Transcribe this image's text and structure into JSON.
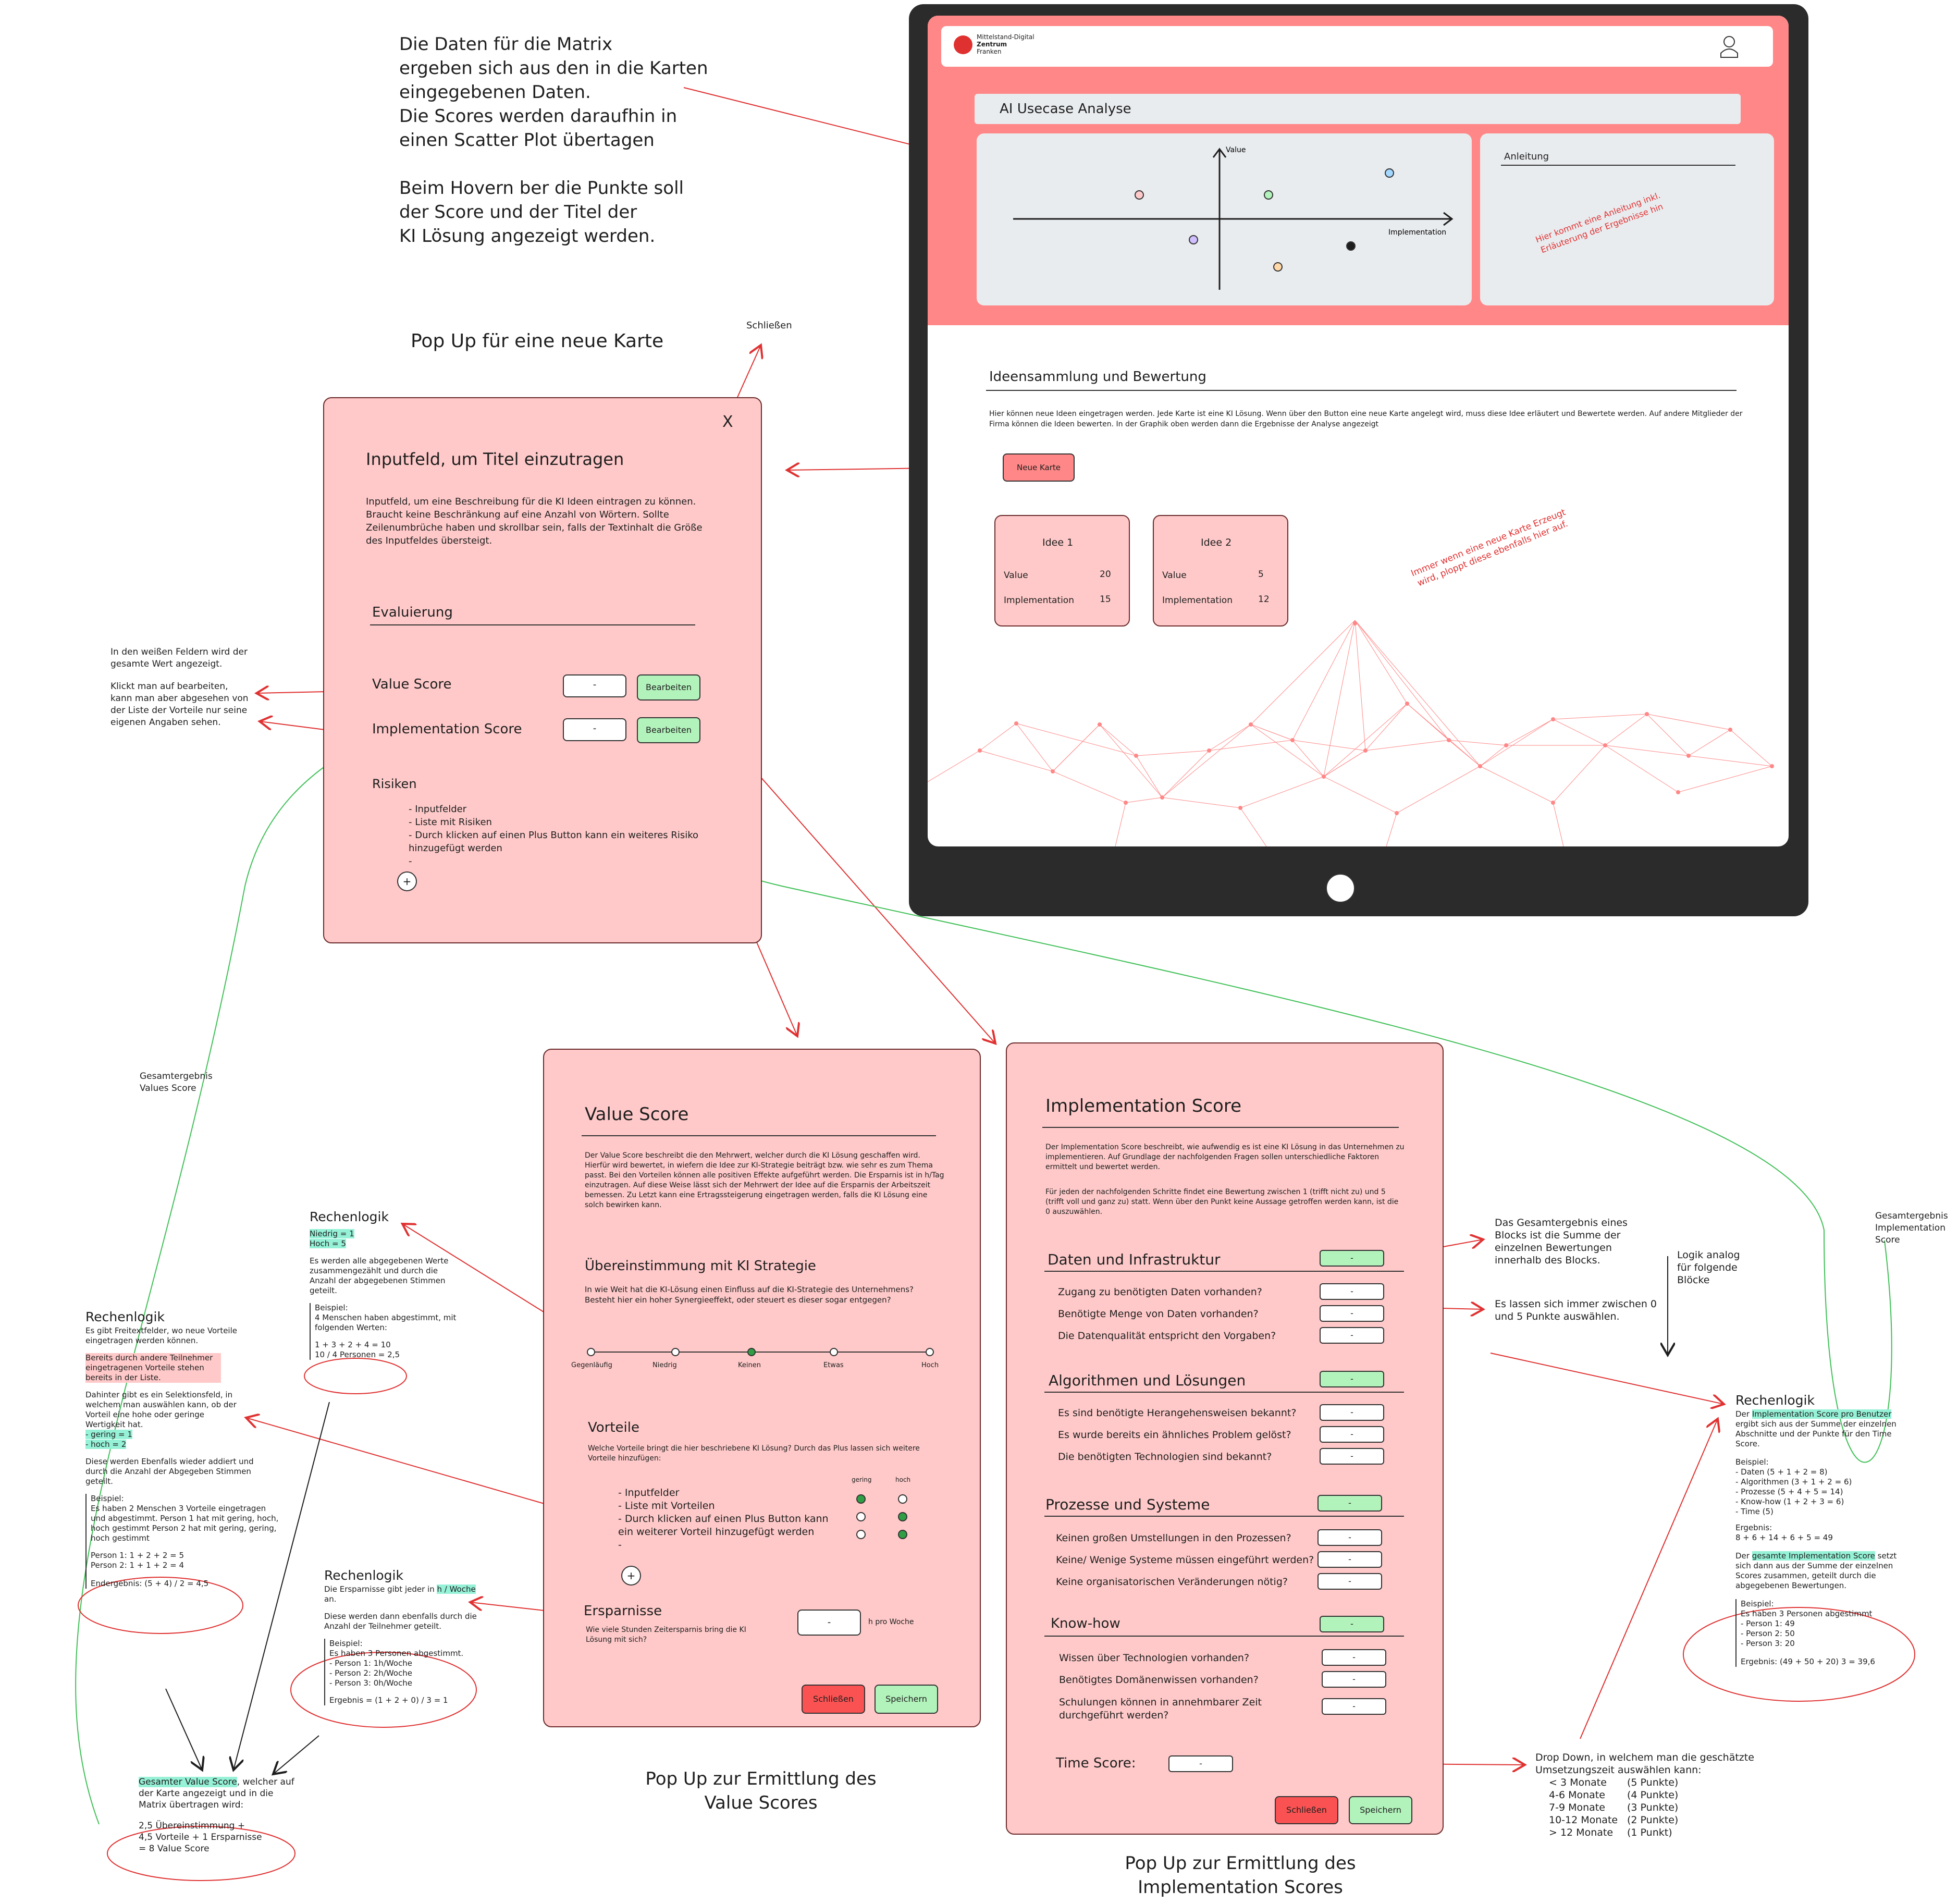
{
  "top_note": {
    "lines": [
      "Die Daten für die Matrix",
      "ergeben sich aus den in die Karten",
      "eingegebenen Daten.",
      "Die Scores werden daraufhin in",
      "einen Scatter Plot übertagen",
      "",
      "Beim Hovern ber die Punkte soll",
      "der Score und der Titel der",
      "KI Lösung angezeigt werden."
    ]
  },
  "popup_new_card_title": "Pop Up für eine neue Karte",
  "close_label": "Schließen",
  "tablet": {
    "logo_line1": "Mittelstand-Digital",
    "logo_line2": "Zentrum",
    "logo_line3": "Franken",
    "analysis_title": "AI Usecase Analyse",
    "axis_value": "Value",
    "axis_impl": "Implementation",
    "instructions_title": "Anleitung",
    "instructions_note": "Hier kommt eine Anleitung inkl. Erläuterung der Ergebnisse hin",
    "ideas_title": "Ideensammlung und Bewertung",
    "ideas_text": "Hier können neue Ideen eingetragen werden. Jede Karte ist eine KI Lösung. Wenn über den Button eine neue Karte angelegt wird, muss diese Idee erläutert und Bewertete werden. Auf andere Mitglieder der Firma können die Ideen bewerten. In der Graphik oben werden dann die Ergebnisse der Analyse angezeigt",
    "new_card_button": "Neue Karte",
    "cards": [
      {
        "title": "Idee 1",
        "value_label": "Value",
        "value": "20",
        "impl_label": "Implementation",
        "impl": "15"
      },
      {
        "title": "Idee 2",
        "value_label": "Value",
        "value": "5",
        "impl_label": "Implementation",
        "impl": "12"
      }
    ],
    "new_card_note": "Immer wenn eine neue Karte Erzeugt wird, ploppt diese ebenfalls hier auf."
  },
  "new_card_popup": {
    "close_x": "X",
    "title_field": "Inputfeld, um Titel einzutragen",
    "desc_field": "Inputfeld, um eine Beschreibung für die KI Ideen eintragen zu können. Braucht keine Beschränkung auf eine Anzahl von Wörtern. Sollte Zeilenumbrüche haben und skrollbar sein, falls der Textinhalt die Größe des Inputfeldes übersteigt.",
    "eval_title": "Evaluierung",
    "value_score_label": "Value Score",
    "impl_score_label": "Implementation Score",
    "field_placeholder": "-",
    "edit_button": "Bearbeiten",
    "risks_title": "Risiken",
    "risks_items": [
      "Inputfelder",
      "Liste mit Risiken",
      "Durch klicken auf einen Plus Button kann ein weiteres Risiko hinzugefügt werden",
      ""
    ],
    "plus": "+"
  },
  "left_note": {
    "p1": "In den weißen Feldern wird der gesamte Wert angezeigt.",
    "p2": "Klickt man auf bearbeiten, kann man aber abgesehen von der Liste der Vorteile nur seine eigenen Angaben sehen."
  },
  "green_label_left": "Gesamtergebnis Values Score",
  "green_label_right": "Gesamtergebnis Implementation Score",
  "value_popup": {
    "title": "Value Score",
    "desc": "Der Value Score beschreibt die den Mehrwert, welcher durch die KI Lösung geschaffen wird. Hierfür wird bewertet, in wiefern die Idee zur KI-Strategie beiträgt bzw. wie sehr es zum Thema passt. Bei den Vorteilen können alle positiven Effekte aufgeführt werden. Die Ersparnis ist in h/Tag einzutragen. Auf diese Weise lässt sich der Mehrwert der Idee auf die Ersparnis der Arbeitszeit bemessen. Zu Letzt kann eine Ertragssteigerung eingetragen werden, falls die KI Lösung eine solch bewirken kann.",
    "strategy_title": "Übereinstimmung mit KI Strategie",
    "strategy_q": "In wie Weit hat die KI-Lösung einen Einfluss auf die KI-Strategie des Unternehmens? Besteht hier ein hoher Synergieeffekt, oder steuert es dieser sogar entgegen?",
    "scale": [
      "Gegenläufig",
      "Niedrig",
      "Keinen",
      "Etwas",
      "Hoch"
    ],
    "advantages_title": "Vorteile",
    "advantages_q": "Welche Vorteile bringt die hier beschriebene KI Lösung? Durch das Plus lassen sich weitere Vorteile hinzufügen:",
    "col_low": "gering",
    "col_high": "hoch",
    "advantages_items": [
      "Inputfelder",
      "Liste mit Vorteilen",
      "Durch klicken auf einen Plus Button kann ein weiterer Vorteil hinzugefügt werden",
      ""
    ],
    "plus": "+",
    "savings_title": "Ersparnisse",
    "savings_q": "Wie viele Stunden Zeitersparnis bring die KI Lösung mit sich?",
    "savings_field": "-",
    "savings_unit": "h pro Woche",
    "close_button": "Schließen",
    "save_button": "Speichern",
    "caption": "Pop Up zur Ermittlung des Value Scores"
  },
  "impl_popup": {
    "title": "Implementation Score",
    "desc1": "Der Implementation Score beschreibt, wie aufwendig es ist eine KI Lösung in das Unternehmen zu implementieren. Auf Grundlage der nachfolgenden Fragen sollen unterschiedliche Faktoren ermittelt und bewertet werden.",
    "desc2": "Für jeden der nachfolgenden Schritte findet eine Bewertung zwischen 1 (trifft nicht zu) und 5 (trifft voll und ganz zu) statt. Wenn über den Punkt keine Aussage getroffen werden kann, ist die 0 auszuwählen.",
    "sections": [
      {
        "title": "Daten und Infrastruktur",
        "questions": [
          "Zugang zu benötigten Daten vorhanden?",
          "Benötigte Menge von Daten vorhanden?",
          "Die Datenqualität entspricht den Vorgaben?"
        ]
      },
      {
        "title": "Algorithmen und Lösungen",
        "questions": [
          "Es sind benötigte Herangehensweisen bekannt?",
          "Es wurde bereits ein ähnliches Problem gelöst?",
          "Die benötigten Technologien sind bekannt?"
        ]
      },
      {
        "title": "Prozesse und Systeme",
        "questions": [
          "Keinen großen Umstellungen in den Prozessen?",
          "Keine/ Wenige Systeme müssen eingeführt werden?",
          "Keine organisatorischen Veränderungen nötig?"
        ]
      },
      {
        "title": "Know-how",
        "questions": [
          "Wissen über Technologien vorhanden?",
          "Benötigtes Domänenwissen vorhanden?",
          "Schulungen können in annehmbarer Zeit durchgeführt werden?"
        ]
      }
    ],
    "pill": "-",
    "time_label": "Time Score:",
    "close_button": "Schließen",
    "save_button": "Speichern",
    "caption": "Pop Up zur Ermittlung des Implementation Scores"
  },
  "impl_notes": {
    "block_sum": "Das Gesamtergebnis eines Blocks ist die Summe der einzelnen Bewertungen innerhalb des Blocks.",
    "logic_analog": "Logik analog für folgende Blöcke",
    "range": "Es lassen sich immer zwischen 0 und 5 Punkte auswählen.",
    "dropdown_title": "Drop Down, in welchem man die geschätzte Umsetzungszeit auswählen kann:",
    "dropdown_rows": [
      [
        "< 3 Monate",
        "(5 Punkte)"
      ],
      [
        "4-6 Monate",
        "(4 Punkte)"
      ],
      [
        "7-9 Monate",
        "(3 Punkte)"
      ],
      [
        "10-12 Monate",
        "(2 Punkte)"
      ],
      [
        "> 12 Monate",
        "(1 Punkt)"
      ]
    ]
  },
  "impl_logic": {
    "title": "Rechenlogik",
    "p1_pre": "Der ",
    "p1_hl": "Implementation Score pro Benutzer",
    "p1_post": " ergibt sich aus der Summe der einzelnen Abschnitte und der Punkte für den Time Score.",
    "ex_title": "Beispiel:",
    "ex_items": [
      "- Daten (5 + 1 + 2 = 8)",
      "- Algorithmen (3 + 1 + 2 = 6)",
      "- Prozesse (5 + 4 + 5 = 14)",
      "- Know-how (1 + 2 + 3 = 6)",
      "- Time (5)"
    ],
    "result_title": "Ergebnis:",
    "result": "8 + 6 + 14 + 6 + 5 = 49",
    "p2_pre": "Der ",
    "p2_hl": "gesamte Implementation Score",
    "p2_post": " setzt sich dann aus der Summe der einzelnen Scores zusammen, geteilt durch die abgegebenen Bewertungen.",
    "ex2_title": "Beispiel:",
    "ex2_items": [
      "Es haben 3 Personen abgestimmt",
      "- Person 1: 49",
      "- Person 2: 50",
      "- Person 3: 20"
    ],
    "ex2_result": "Ergebnis: (49 + 50 + 20) 3 = 39,6"
  },
  "logic_strategy": {
    "title": "Rechenlogik",
    "hl1": "Niedrig = 1",
    "hl2": "Hoch = 5",
    "p": "Es werden alle abgegebenen Werte zusammengezählt und durch die Anzahl der abgegebenen Stimmen geteilt.",
    "ex_title": "Beispiel:",
    "ex": "4 Menschen haben abgestimmt, mit folgenden Werten:",
    "calc1": "1 + 3 + 2 + 4 = 10",
    "calc2": "10 / 4 Personen = 2,5"
  },
  "logic_advantages": {
    "title": "Rechenlogik",
    "p1": "Es gibt Freitextfelder, wo neue Vorteile eingetragen werden können.",
    "hl_red": "Bereits durch andere Teilnehmer eingetragenen Vorteile stehen bereits in der Liste.",
    "p2": "Dahinter gibt es ein Selektionsfeld, in welchem man auswählen kann, ob der Vorteil eine hohe oder geringe Wertigkeit hat.",
    "hl1": "- gering = 1",
    "hl2": "- hoch = 2",
    "p3": "Diese werden Ebenfalls wieder addiert und durch die Anzahl der Abgegeben Stimmen geteilt.",
    "ex_title": "Beispiel:",
    "ex": "Es haben 2 Menschen 3 Vorteile eingetragen und abgestimmt. Person 1 hat mit gering, hoch, hoch gestimmt Person 2 hat mit gering, gering, hoch gestimmt",
    "calc1": "Person 1: 1 + 2 + 2 = 5",
    "calc2": "Person 2: 1 + 1 + 2 = 4",
    "calc3": "Endergebnis: (5 + 4) / 2 = 4,5"
  },
  "logic_savings": {
    "title": "Rechenlogik",
    "p1_pre": "Die Ersparnisse gibt jeder in ",
    "p1_hl": "h / Woche",
    "p1_post": " an.",
    "p2": "Diese werden dann ebenfalls durch die Anzahl der Teilnehmer geteilt.",
    "ex_title": "Beispiel:",
    "ex_items": [
      "Es haben 3 Personen abgestimmt.",
      "- Person 1:  1h/Woche",
      "- Person 2:  2h/Woche",
      "- Person 3:  0h/Woche"
    ],
    "result": "Ergebnis = (1 + 2 + 0) / 3 = 1"
  },
  "total_value": {
    "hl": "Gesamter Value Score",
    "text": ", welcher auf der Karte angezeigt und in die Matrix übertragen wird:",
    "calc": [
      "2,5 Übereinstimmung +",
      "4,5 Vorteile + 1 Ersparnisse",
      "= 8 Value Score"
    ]
  },
  "colors": {
    "accent": "#ff8787",
    "popup": "#ffc9c9",
    "green": "#b2f2bb",
    "red_arrow": "#e03131",
    "green_line": "#40c057",
    "dark": "#1e1e1e"
  }
}
